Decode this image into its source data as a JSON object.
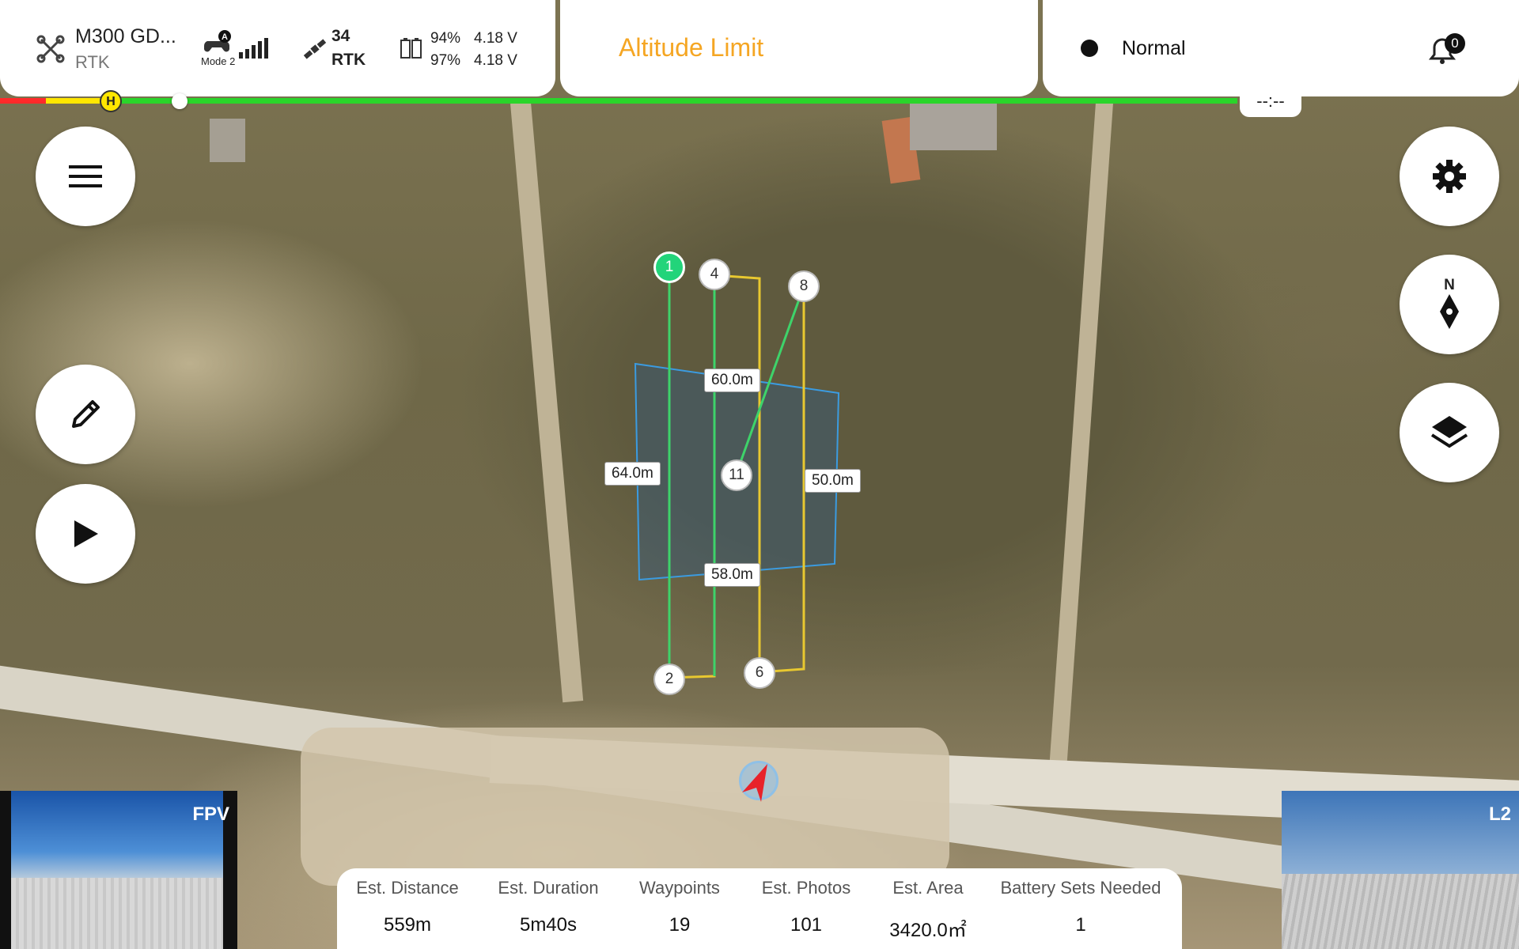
{
  "aircraft": {
    "name": "M300 GD...",
    "positioning": "RTK",
    "icon": "drone-icon"
  },
  "controller": {
    "mode_badge": "A",
    "mode_label": "Mode 2",
    "icon": "gamepad-icon",
    "signal_icon": "signal-bars-icon"
  },
  "satellites": {
    "count": "34",
    "type": "RTK",
    "icon": "satellite-icon"
  },
  "batteries": [
    {
      "percent": "94%",
      "voltage": "4.18 V"
    },
    {
      "percent": "97%",
      "voltage": "4.18 V"
    }
  ],
  "warning": {
    "text": "Altitude Limit",
    "color": "#f5a623"
  },
  "status": {
    "text": "Normal"
  },
  "notifications": {
    "count": "0"
  },
  "progress": {
    "home_marker": "H",
    "time_label": "--:--",
    "colors": {
      "red": "#ff2a2a",
      "yellow": "#ffe600",
      "green": "#2ad52a"
    }
  },
  "left_buttons": [
    "menu-icon",
    "pencil-icon",
    "play-icon"
  ],
  "right_buttons": {
    "compass_label": "N"
  },
  "route": {
    "waypoints": [
      {
        "label": "1",
        "active": true
      },
      {
        "label": "4"
      },
      {
        "label": "8"
      },
      {
        "label": "11"
      },
      {
        "label": "2"
      },
      {
        "label": "6"
      }
    ],
    "distances": [
      "60.0m",
      "64.0m",
      "50.0m",
      "58.0m"
    ]
  },
  "cameras": {
    "left": "FPV",
    "right": "L2"
  },
  "stats": [
    {
      "label": "Est. Distance",
      "value": "559m"
    },
    {
      "label": "Est. Duration",
      "value": "5m40s"
    },
    {
      "label": "Waypoints",
      "value": "19"
    },
    {
      "label": "Est. Photos",
      "value": "101"
    },
    {
      "label": "Est. Area",
      "value": "3420.0㎡"
    },
    {
      "label": "Battery Sets Needed",
      "value": "1"
    }
  ]
}
